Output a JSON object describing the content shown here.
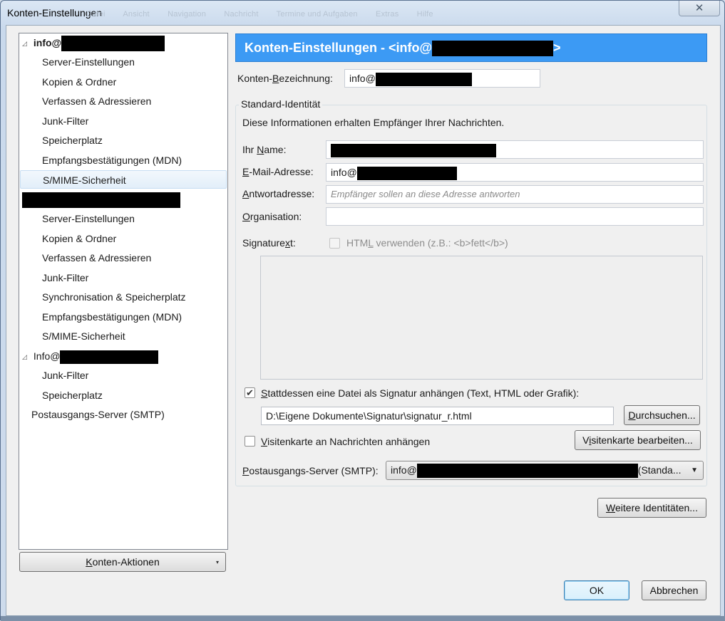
{
  "window": {
    "title": "Konten-Einstellungen",
    "ghost_menu": [
      "Datei",
      "Ansicht",
      "Navigation",
      "Nachricht",
      "Termine und Aufgaben",
      "Extras",
      "Hilfe"
    ],
    "close_glyph": "✕"
  },
  "sidebar": {
    "accounts": [
      {
        "name": "info@",
        "expanded": true,
        "items": [
          "Server-Einstellungen",
          "Kopien & Ordner",
          "Verfassen & Adressieren",
          "Junk-Filter",
          "Speicherplatz",
          "Empfangsbestätigungen (MDN)",
          "S/MIME-Sicherheit"
        ],
        "selected_index": 6
      },
      {
        "name": "",
        "expanded": true,
        "items": [
          "Server-Einstellungen",
          "Kopien & Ordner",
          "Verfassen & Adressieren",
          "Junk-Filter",
          "Synchronisation & Speicherplatz",
          "Empfangsbestätigungen (MDN)",
          "S/MIME-Sicherheit"
        ]
      },
      {
        "name": "Info@",
        "expanded": true,
        "items": [
          "Junk-Filter",
          "Speicherplatz"
        ]
      }
    ],
    "smtp_item": "Postausgangs-Server (SMTP)",
    "expand_glyph": "◿"
  },
  "actions_button": {
    "label_prefix": "",
    "label_accel": "K",
    "label_rest": "onten-Aktionen",
    "caret": "▾"
  },
  "panel": {
    "header_prefix": "Konten-Einstellungen - <info@",
    "header_suffix": ">",
    "account_name_label_a": "Konten-",
    "account_name_label_accel": "B",
    "account_name_label_b": "ezeichnung:",
    "account_name_value": "info@",
    "identity": {
      "legend": "Standard-Identität",
      "description": "Diese Informationen erhalten Empfänger Ihrer Nachrichten.",
      "name_label_a": "Ihr ",
      "name_label_accel": "N",
      "name_label_b": "ame:",
      "name_value": "",
      "email_label_accel": "E",
      "email_label_b": "-Mail-Adresse:",
      "email_value": "info@",
      "reply_label_accel": "A",
      "reply_label_b": "ntwortadresse:",
      "reply_placeholder": "Empfänger sollen an diese Adresse antworten",
      "org_label_accel": "O",
      "org_label_b": "rganisation:",
      "org_value": "",
      "sig_label_a": "Signature",
      "sig_label_accel": "x",
      "sig_label_b": "t:",
      "html_checkbox_a": "HTM",
      "html_checkbox_accel": "L",
      "html_checkbox_b": " verwenden (z.B.: <b>fett</b>)",
      "html_checked": false,
      "sig_file_checked": true,
      "sig_file_label_accel": "S",
      "sig_file_label_b": "tattdessen eine Datei als Signatur anhängen (Text, HTML oder Grafik):",
      "sig_file_path": "D:\\Eigene Dokumente\\Signatur\\signatur_r.html",
      "browse_accel": "D",
      "browse_rest": "urchsuchen...",
      "vcard_checked": false,
      "vcard_label_accel": "V",
      "vcard_label_b": "isitenkarte an Nachrichten anhängen",
      "vcard_edit_a": "V",
      "vcard_edit_accel": "i",
      "vcard_edit_b": "sitenkarte bearbeiten...",
      "smtp_label_accel": "P",
      "smtp_label_b": "ostausgangs-Server (SMTP):",
      "smtp_value_prefix": "info@",
      "smtp_value_suffix": "(Standa...",
      "smtp_arrow": "▼",
      "check_glyph": "✔"
    },
    "more_identities_accel": "W",
    "more_identities_rest": "eitere Identitäten..."
  },
  "footer": {
    "ok": "OK",
    "cancel": "Abbrechen"
  }
}
